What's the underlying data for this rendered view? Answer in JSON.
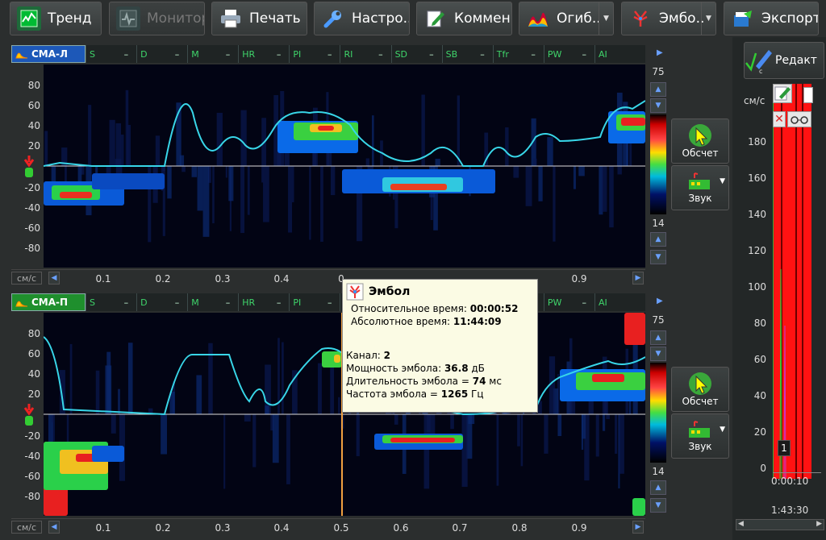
{
  "toolbar": {
    "trend": "Тренд",
    "monitor": "Монитор",
    "print": "Печать",
    "settings": "Настро..",
    "comments": "Коммен..",
    "envelope": "Огиб..",
    "emboli": "Эмбо..",
    "export": "Экспорт"
  },
  "channels": [
    {
      "name": "СМА-Л",
      "params": [
        {
          "label": "S",
          "value": "–"
        },
        {
          "label": "D",
          "value": "–"
        },
        {
          "label": "M",
          "value": "–"
        },
        {
          "label": "HR",
          "value": "–"
        },
        {
          "label": "PI",
          "value": "–"
        },
        {
          "label": "RI",
          "value": "–"
        },
        {
          "label": "SD",
          "value": "–"
        },
        {
          "label": "SB",
          "value": "–"
        },
        {
          "label": "Tfr",
          "value": "–"
        },
        {
          "label": "PW",
          "value": "–"
        },
        {
          "label": "AI",
          "value": ""
        }
      ],
      "scale_top": "75",
      "scale_bottom": "14",
      "recalc": "Обсчет",
      "sound": "Звук"
    },
    {
      "name": "СМА-П",
      "params": [
        {
          "label": "S",
          "value": "–"
        },
        {
          "label": "D",
          "value": "–"
        },
        {
          "label": "M",
          "value": "–"
        },
        {
          "label": "HR",
          "value": "–"
        },
        {
          "label": "PI",
          "value": "–"
        },
        {
          "label": "RI",
          "value": "–"
        },
        {
          "label": "SD",
          "value": "–"
        },
        {
          "label": "SB",
          "value": "–"
        },
        {
          "label": "Tfr",
          "value": "–"
        },
        {
          "label": "PW",
          "value": "–"
        },
        {
          "label": "AI",
          "value": ""
        }
      ],
      "scale_top": "75",
      "scale_bottom": "14",
      "recalc": "Обсчет",
      "sound": "Звук"
    }
  ],
  "yticks": [
    "80",
    "60",
    "40",
    "20",
    "-20",
    "-40",
    "-60",
    "-80"
  ],
  "xticks": [
    "0.1",
    "0.2",
    "0.3",
    "0.4",
    "0.5",
    "0.6",
    "0.7",
    "0.8",
    "0.9"
  ],
  "xticks_top_visible": [
    "0.1",
    "0.2",
    "0.3",
    "0.4",
    "0",
    "0.9"
  ],
  "unit": "см/с",
  "right_panel": {
    "edit": "Редакт",
    "unit": "см/с",
    "ticks": [
      "180",
      "160",
      "140",
      "120",
      "100",
      "80",
      "60",
      "40",
      "20",
      "0"
    ],
    "marker": "1",
    "time1": "0:00:10",
    "time2": "1:43:30"
  },
  "tooltip": {
    "title": "Эмбол",
    "rel_time_label": "Относительное время:",
    "rel_time": "00:00:52",
    "abs_time_label": "Абсолютное время:",
    "abs_time": "11:44:09",
    "channel_label": "Канал:",
    "channel": "2",
    "power_label": "Мощность эмбола:",
    "power": "36.8",
    "power_unit": "дБ",
    "duration_label": "Длительность эмбола =",
    "duration": "74",
    "duration_unit": "мс",
    "freq_label": "Частота эмбола =",
    "freq": "1265",
    "freq_unit": "Гц"
  },
  "colors": {
    "envelope": "#38d6e8",
    "accent_blue": "#1d58b8",
    "accent_green": "#1f8f2d",
    "trend_red": "#ff1010"
  }
}
